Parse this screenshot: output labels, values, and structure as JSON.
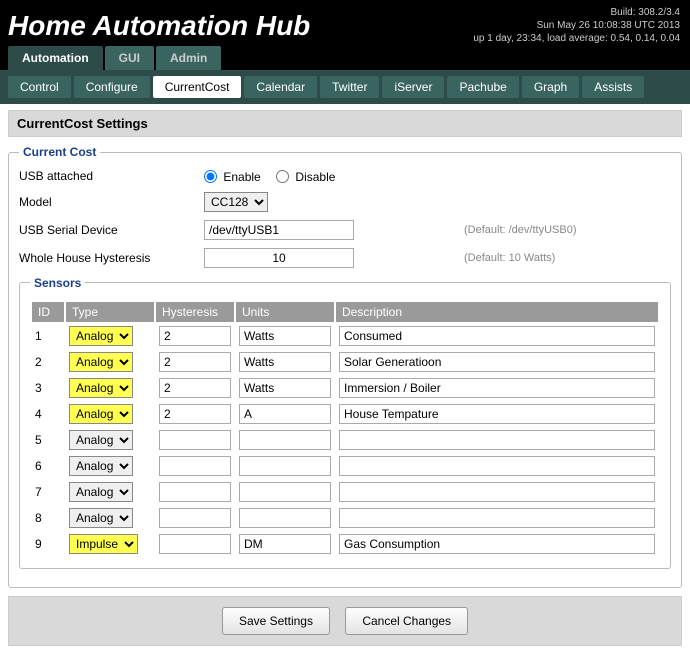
{
  "header": {
    "title": "Home Automation Hub",
    "build": "Build: 308.2/3.4",
    "datetime": "Sun May 26 10:08:38 UTC 2013",
    "uptime": "up 1 day, 23:34, load average: 0.54, 0.14, 0.04"
  },
  "tabs_primary": [
    "Automation",
    "GUI",
    "Admin"
  ],
  "tabs_primary_active": 0,
  "tabs_secondary": [
    "Control",
    "Configure",
    "CurrentCost",
    "Calendar",
    "Twitter",
    "iServer",
    "Pachube",
    "Graph",
    "Assists"
  ],
  "tabs_secondary_active": 2,
  "page_title": "CurrentCost Settings",
  "fieldset_current_cost": "Current Cost",
  "fieldset_sensors": "Sensors",
  "form": {
    "usb_attached_label": "USB attached",
    "enable_label": "Enable",
    "disable_label": "Disable",
    "usb_attached_value": "enable",
    "model_label": "Model",
    "model_value": "CC128",
    "usb_serial_label": "USB Serial Device",
    "usb_serial_value": "/dev/ttyUSB1",
    "usb_serial_hint": "(Default: /dev/ttyUSB0)",
    "hysteresis_label": "Whole House Hysteresis",
    "hysteresis_value": "10",
    "hysteresis_hint": "(Default: 10 Watts)"
  },
  "sensor_columns": {
    "id": "ID",
    "type": "Type",
    "hys": "Hysteresis",
    "units": "Units",
    "desc": "Description"
  },
  "sensors": [
    {
      "id": "1",
      "type": "Analog",
      "hl": true,
      "hys": "2",
      "units": "Watts",
      "desc": "Consumed"
    },
    {
      "id": "2",
      "type": "Analog",
      "hl": true,
      "hys": "2",
      "units": "Watts",
      "desc": "Solar Generatioon"
    },
    {
      "id": "3",
      "type": "Analog",
      "hl": true,
      "hys": "2",
      "units": "Watts",
      "desc": "Immersion / Boiler"
    },
    {
      "id": "4",
      "type": "Analog",
      "hl": true,
      "hys": "2",
      "units": "A",
      "desc": "House Tempature"
    },
    {
      "id": "5",
      "type": "Analog",
      "hl": false,
      "hys": "",
      "units": "",
      "desc": ""
    },
    {
      "id": "6",
      "type": "Analog",
      "hl": false,
      "hys": "",
      "units": "",
      "desc": ""
    },
    {
      "id": "7",
      "type": "Analog",
      "hl": false,
      "hys": "",
      "units": "",
      "desc": ""
    },
    {
      "id": "8",
      "type": "Analog",
      "hl": false,
      "hys": "",
      "units": "",
      "desc": ""
    },
    {
      "id": "9",
      "type": "Impulse",
      "hl": true,
      "hys": "",
      "units": "DM",
      "desc": "Gas Consumption"
    }
  ],
  "buttons": {
    "save": "Save Settings",
    "cancel": "Cancel Changes"
  }
}
